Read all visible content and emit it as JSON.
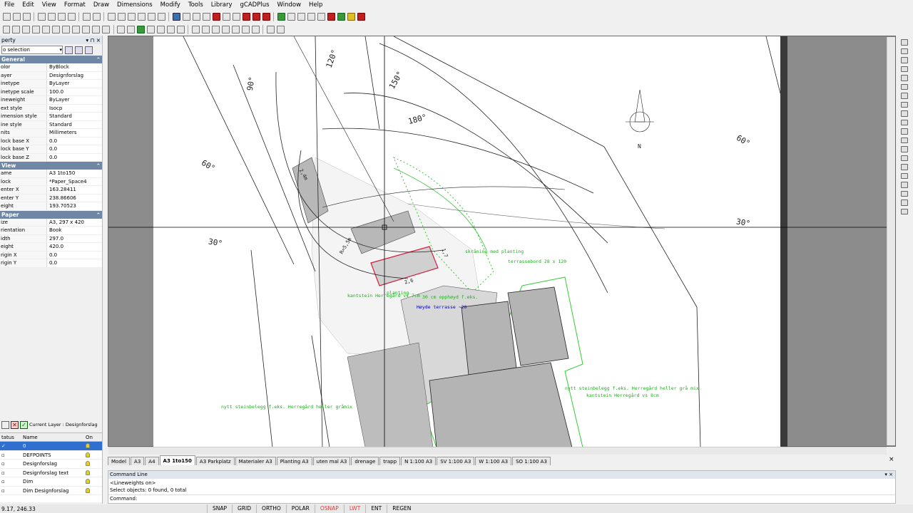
{
  "menu": [
    "File",
    "Edit",
    "View",
    "Format",
    "Draw",
    "Dimensions",
    "Modify",
    "Tools",
    "Library",
    "gCADPlus",
    "Window",
    "Help"
  ],
  "property_panel": {
    "title": "perty",
    "selection": "o selection",
    "sections": [
      {
        "name": "General",
        "rows": [
          [
            "olor",
            "ByBlock"
          ],
          [
            "ayer",
            "Designforslag"
          ],
          [
            "inetype",
            "ByLayer"
          ],
          [
            "inetype scale",
            "100.0"
          ],
          [
            "ineweight",
            "ByLayer"
          ],
          [
            "ext style",
            "Isocp"
          ],
          [
            "imension style",
            "Standard"
          ],
          [
            "ine style",
            "Standard"
          ],
          [
            "nits",
            "Millimeters"
          ],
          [
            "lock base X",
            "0.0"
          ],
          [
            "lock base Y",
            "0.0"
          ],
          [
            "lock base Z",
            "0.0"
          ]
        ]
      },
      {
        "name": "View",
        "rows": [
          [
            "ame",
            "A3 1to150"
          ],
          [
            "lock",
            "*Paper_Space4"
          ],
          [
            "enter X",
            "163.28411"
          ],
          [
            "enter Y",
            "238.86606"
          ],
          [
            "eight",
            "193.70523"
          ]
        ]
      },
      {
        "name": "Paper",
        "rows": [
          [
            "ize",
            "A3, 297 x 420"
          ],
          [
            "rientation",
            "Book"
          ],
          [
            "idth",
            "297.0"
          ],
          [
            "eight",
            "420.0"
          ],
          [
            "rigin X",
            "0.0"
          ],
          [
            "rigin Y",
            "0.0"
          ]
        ]
      }
    ]
  },
  "layer_panel": {
    "current_layer": "Current Layer : Designforslag",
    "headers": [
      "tatus",
      "Name",
      "On"
    ],
    "rows": [
      "0",
      "DEFPOINTS",
      "Designforslag",
      "Designforslag text",
      "Dim",
      "Dim Designforslag"
    ]
  },
  "tabs": [
    "Model",
    "A3",
    "A4",
    "A3 1to150",
    "A3 Parkplatz",
    "Materialer A3",
    "Planting A3",
    "uten mal A3",
    "drenage",
    "trapp",
    "N 1:100 A3",
    "SV 1:100 A3",
    "W 1:100 A3",
    "SO 1:100 A3"
  ],
  "active_tab": "A3 1to150",
  "command": {
    "title": "Command Line",
    "lines": [
      "<Lineweights on>",
      "Select objects: 0 found,  0 total"
    ],
    "prompt": "Command:"
  },
  "status": {
    "coords": "9.17, 246.33",
    "toggles": [
      "SNAP",
      "GRID",
      "ORTHO",
      "POLAR",
      "OSNAP",
      "LWT",
      "ENT",
      "REGEN"
    ]
  },
  "drawing_labels": [
    "120°",
    "90°",
    "150°",
    "180°",
    "60°",
    "60°",
    "30°",
    "30°",
    "N",
    "skråning med planting",
    "terrassebord 28 x 120",
    "30 cm opphøyd f.eks.",
    "Høyde terrasse ~20",
    "planting",
    "kantstein Herregård vs 7cm",
    "nytt steinbelegg f.eks. Herregård heller grå mix",
    "kantstein Herregård vs 8cm",
    "nytt steinbelegg f.eks. Herregård heller gråmix",
    "R=5,5m",
    "2,4m",
    "1,7",
    "2,6"
  ],
  "colors": {
    "accent_red": "#e04040",
    "panel_header": "#6f87a4",
    "paper": "#ffffff",
    "drawing_bg": "#8c8c8c"
  }
}
